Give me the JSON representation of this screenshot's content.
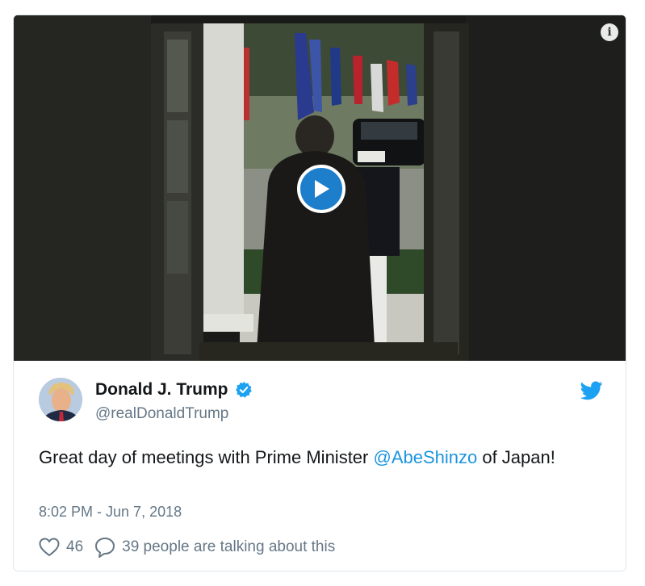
{
  "media": {
    "info_icon": "info-icon",
    "play_icon": "play-icon"
  },
  "tweet": {
    "display_name": "Donald J. Trump",
    "handle": "@realDonaldTrump",
    "verified_icon": "verified-badge-icon",
    "brand_icon": "twitter-bird-icon",
    "text_before": "Great day of meetings with Prime Minister ",
    "mention": "@AbeShinzo",
    "text_after": " of Japan!",
    "timestamp": "8:02 PM - Jun 7, 2018",
    "likes": "46",
    "talking": "39 people are talking about this"
  },
  "colors": {
    "brand": "#1da1f2",
    "link": "#1b95e0",
    "play": "#1d7ecb",
    "muted": "#657786",
    "text": "#14171a"
  }
}
